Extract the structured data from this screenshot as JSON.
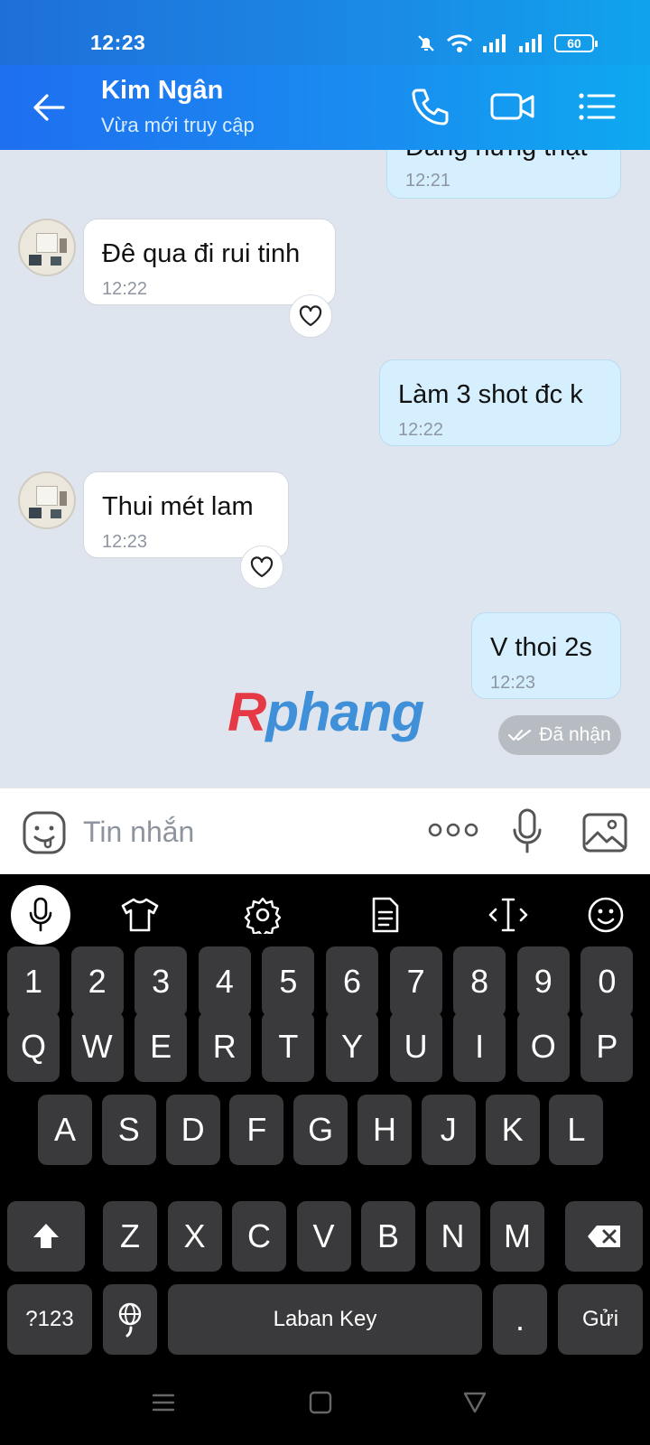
{
  "status_bar": {
    "time": "12:23",
    "battery": "60"
  },
  "header": {
    "contact_name": "Kim Ngân",
    "contact_status": "Vừa mới truy cập"
  },
  "messages": [
    {
      "direction": "out",
      "text": "Đang hứng thật",
      "time": "12:21"
    },
    {
      "direction": "in",
      "text": "Đê qua đi rui tinh",
      "time": "12:22"
    },
    {
      "direction": "out",
      "text": "Làm 3 shot đc k",
      "time": "12:22"
    },
    {
      "direction": "in",
      "text": "Thui mét lam",
      "time": "12:23"
    },
    {
      "direction": "out",
      "text": "V thoi 2s",
      "time": "12:23"
    }
  ],
  "received_status": "Đã nhận",
  "watermark": {
    "part1": "R",
    "part2": "phang"
  },
  "composer": {
    "placeholder": "Tin nhắn"
  },
  "keyboard": {
    "number_row": [
      "1",
      "2",
      "3",
      "4",
      "5",
      "6",
      "7",
      "8",
      "9",
      "0"
    ],
    "row1": [
      "Q",
      "W",
      "E",
      "R",
      "T",
      "Y",
      "U",
      "I",
      "O",
      "P"
    ],
    "row2": [
      "A",
      "S",
      "D",
      "F",
      "G",
      "H",
      "J",
      "K",
      "L"
    ],
    "row3": [
      "Z",
      "X",
      "C",
      "V",
      "B",
      "N",
      "M"
    ],
    "symbols_key": "?123",
    "space_key": "Laban Key",
    "period_key": ".",
    "send_key": "Gửi"
  },
  "colors": {
    "header": "#1a8be6",
    "chat_bg": "#dfe5ee",
    "outgoing_bubble": "#d5efff",
    "incoming_bubble": "#ffffff"
  }
}
